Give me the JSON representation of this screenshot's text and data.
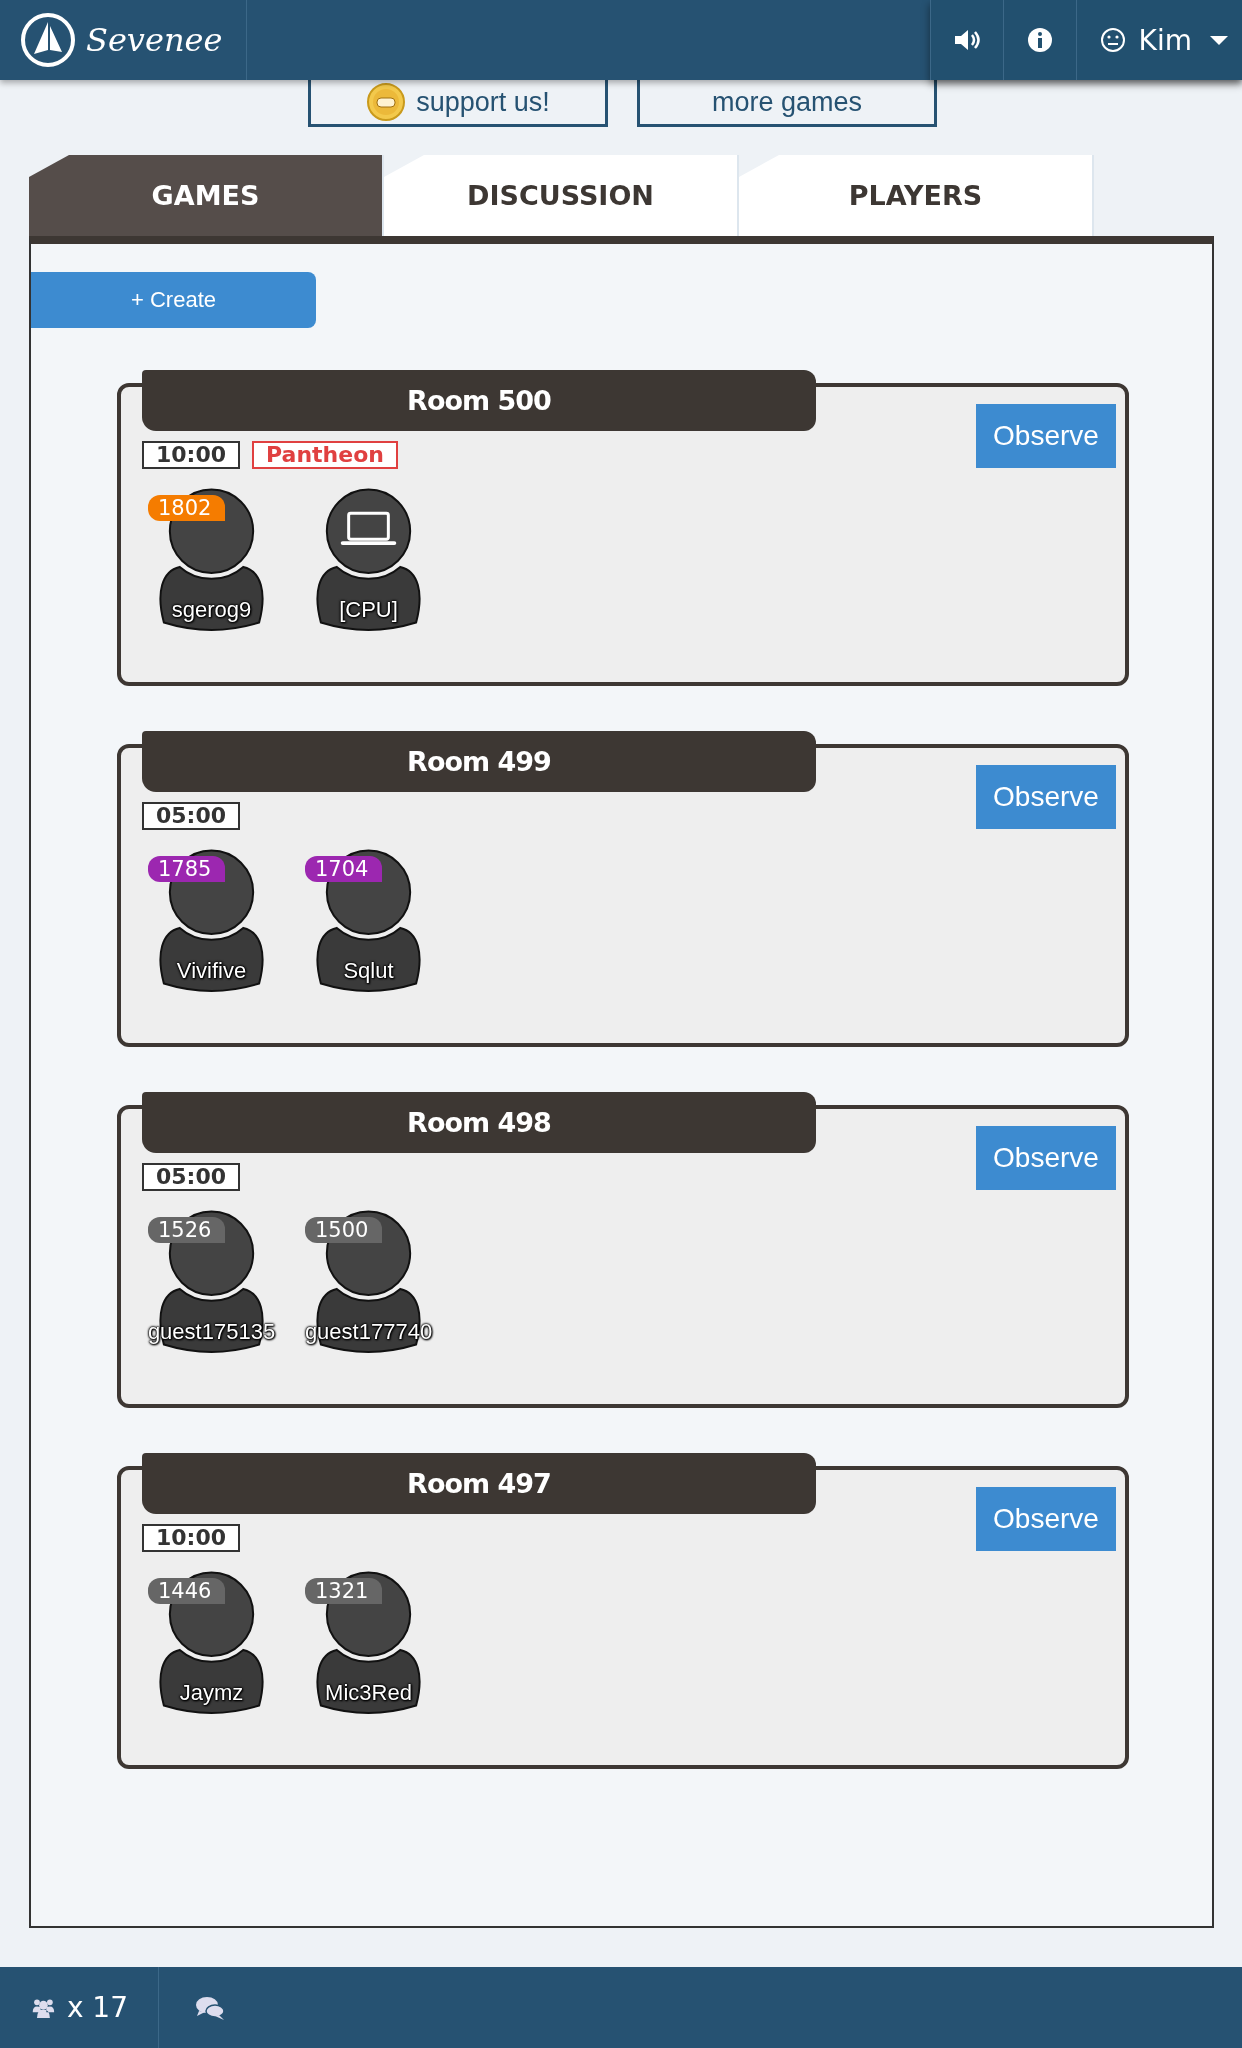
{
  "header": {
    "brand": "Sevenee",
    "user": "Kim"
  },
  "promo_buttons": [
    "support us!",
    "more games"
  ],
  "tabs": [
    {
      "label": "GAMES",
      "selected": true
    },
    {
      "label": "DISCUSSION",
      "selected": false
    },
    {
      "label": "PLAYERS",
      "selected": false
    }
  ],
  "create_button": "+ Create",
  "rooms": [
    {
      "title": "Room 500",
      "time": "10:00",
      "tag": "Pantheon",
      "observe": "Observe",
      "players": [
        {
          "kind": "human",
          "name": "sgerog9",
          "rating": "1802",
          "color": "#f57c00"
        },
        {
          "kind": "cpu",
          "name": "[CPU]"
        }
      ]
    },
    {
      "title": "Room 499",
      "time": "05:00",
      "observe": "Observe",
      "players": [
        {
          "kind": "human",
          "name": "Vivifive",
          "rating": "1785",
          "color": "#9c27b0"
        },
        {
          "kind": "human",
          "name": "Sqlut",
          "rating": "1704",
          "color": "#9c27b0"
        }
      ]
    },
    {
      "title": "Room 498",
      "time": "05:00",
      "observe": "Observe",
      "players": [
        {
          "kind": "human",
          "name": "guest175135",
          "rating": "1526",
          "color": "#666666"
        },
        {
          "kind": "human",
          "name": "guest177740",
          "rating": "1500",
          "color": "#666666"
        }
      ]
    },
    {
      "title": "Room 497",
      "time": "10:00",
      "observe": "Observe",
      "players": [
        {
          "kind": "human",
          "name": "Jaymz",
          "rating": "1446",
          "color": "#666666"
        },
        {
          "kind": "human",
          "name": "Mic3Red",
          "rating": "1321",
          "color": "#666666"
        }
      ]
    }
  ],
  "footer": {
    "online_count": "x 17"
  }
}
